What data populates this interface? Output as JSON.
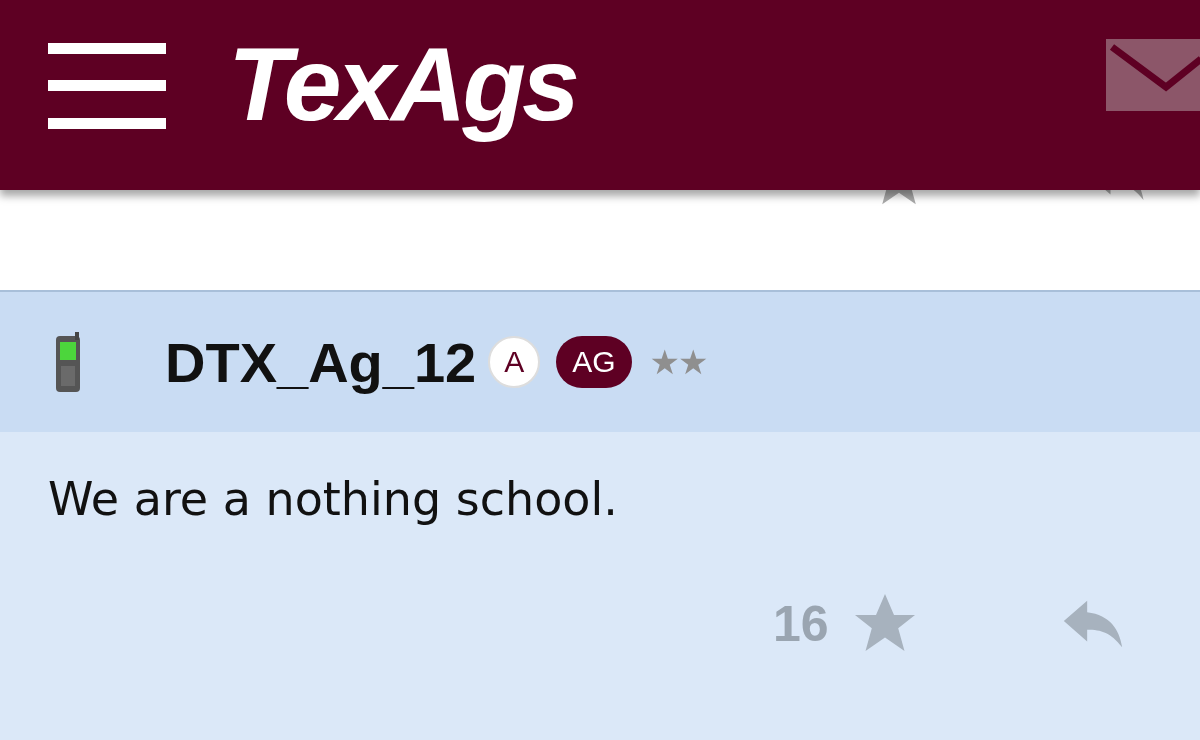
{
  "header": {
    "logo": "TexAgs"
  },
  "post": {
    "author": "DTX_Ag_12",
    "badges": [
      {
        "label": "A",
        "kind": "outline"
      },
      {
        "label": "AG",
        "kind": "filled"
      }
    ],
    "rank": "★★",
    "body": "We are a nothing school.",
    "star_count": "16"
  }
}
